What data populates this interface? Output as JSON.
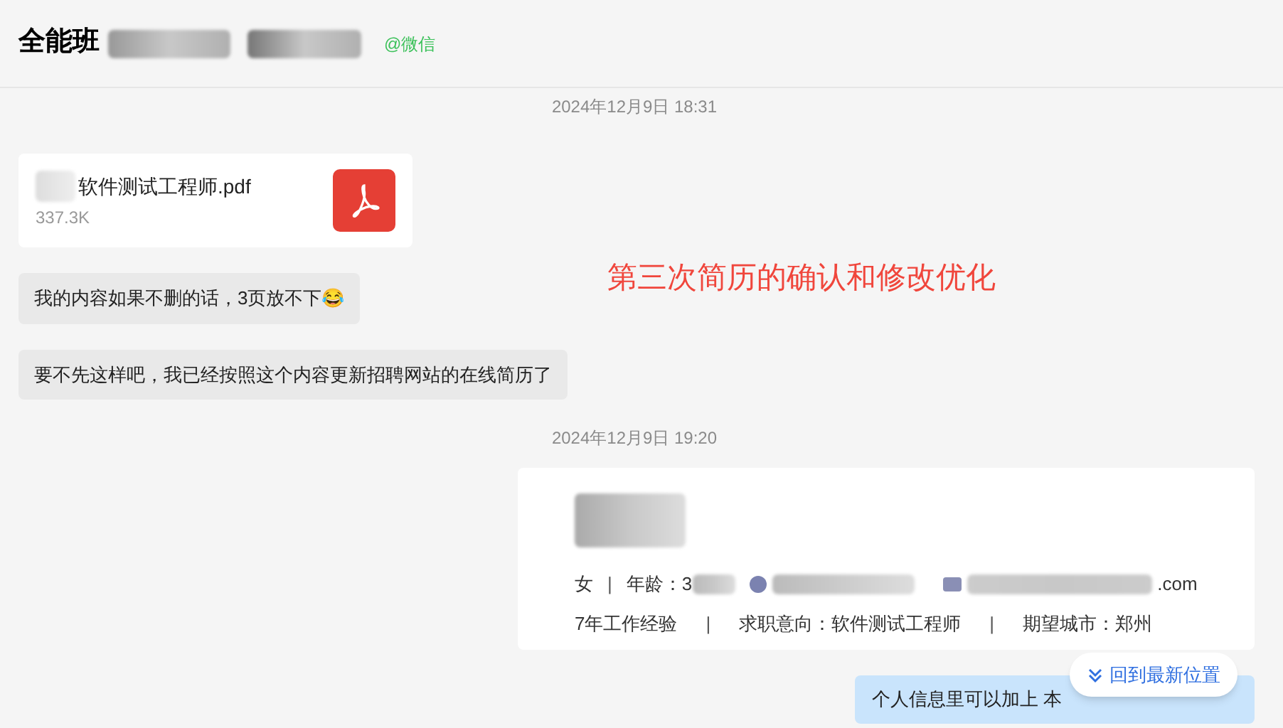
{
  "header": {
    "title": "全能班",
    "source": "@微信"
  },
  "messages": [
    {
      "kind": "time",
      "text": "2024年12月9日 18:31"
    },
    {
      "kind": "file",
      "name": "软件测试工程师.pdf",
      "size": "337.3K"
    },
    {
      "kind": "text",
      "text": "我的内容如果不删的话，3页放不下😂"
    },
    {
      "kind": "text",
      "text": "要不先这样吧，我已经按照这个内容更新招聘网站的在线简历了"
    },
    {
      "kind": "time",
      "text": "2024年12月9日 19:20"
    },
    {
      "kind": "resume",
      "separators": [
        "|",
        "|",
        "|"
      ],
      "gender": "女",
      "age_label": "年龄：3",
      "email_tail": ".com",
      "experience": "7年工作经验",
      "intent": "求职意向：软件测试工程师",
      "city": "期望城市：郑州"
    },
    {
      "kind": "mine",
      "text": "个人信息里可以加上 本"
    }
  ],
  "annotation": "第三次简历的确认和修改优化",
  "jump_button": "回到最新位置"
}
